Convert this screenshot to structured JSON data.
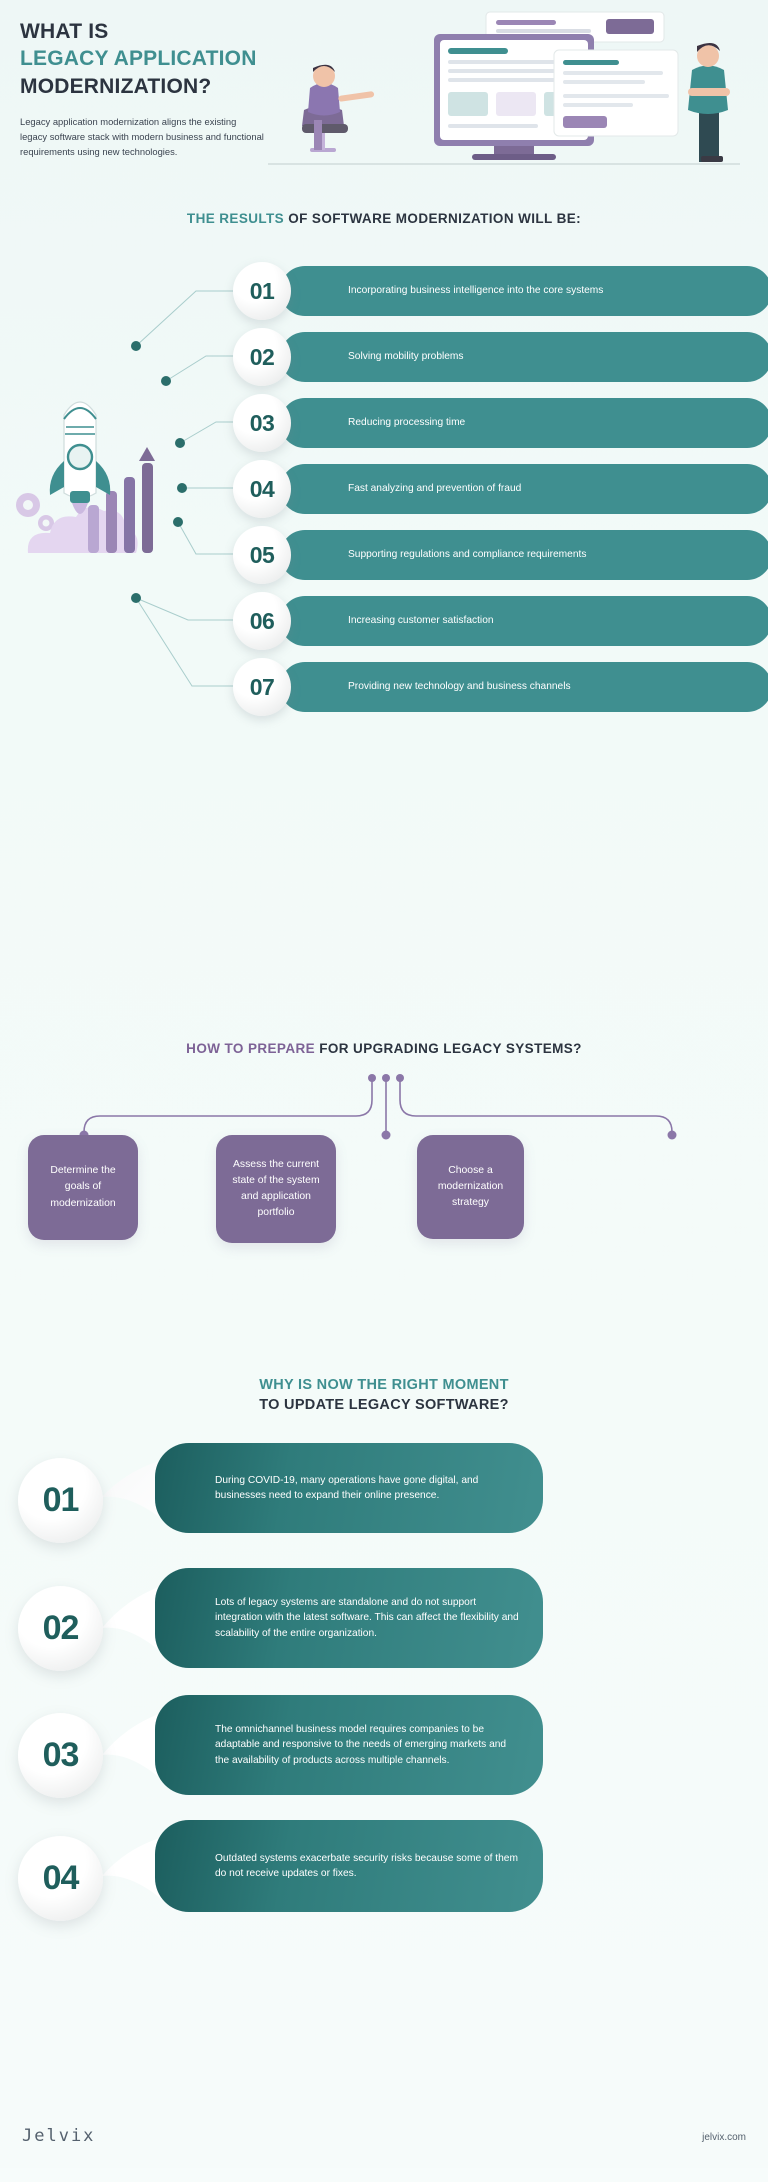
{
  "hero": {
    "title_line1": "WHAT IS",
    "title_line2": "LEGACY APPLICATION",
    "title_line3": "MODERNIZATION?",
    "paragraph": "Legacy application modernization aligns the existing legacy software stack with modern business and functional requirements using new technologies."
  },
  "results": {
    "title_accent": "THE RESULTS",
    "title_rest": " OF SOFTWARE MODERNIZATION WILL BE:",
    "items": [
      {
        "num": "01",
        "text": "Incorporating business intelligence into the core systems"
      },
      {
        "num": "02",
        "text": "Solving mobility problems"
      },
      {
        "num": "03",
        "text": "Reducing processing time"
      },
      {
        "num": "04",
        "text": "Fast analyzing and prevention of fraud"
      },
      {
        "num": "05",
        "text": "Supporting regulations and compliance requirements"
      },
      {
        "num": "06",
        "text": "Increasing customer satisfaction"
      },
      {
        "num": "07",
        "text": "Providing new technology and business channels"
      }
    ]
  },
  "prepare": {
    "title_accent": "HOW TO PREPARE",
    "title_rest": " FOR UPGRADING LEGACY SYSTEMS?",
    "boxes": [
      {
        "text": "Determine the goals of modernization"
      },
      {
        "text": "Assess the current state of the system and application portfolio"
      },
      {
        "text": "Choose a modernization strategy"
      }
    ]
  },
  "why": {
    "title_line1": "WHY IS NOW THE RIGHT MOMENT",
    "title_line2": "TO UPDATE LEGACY SOFTWARE?",
    "items": [
      {
        "num": "01",
        "text": "During COVID-19, many operations have gone digital, and businesses need to expand their online presence."
      },
      {
        "num": "02",
        "text": "Lots of legacy systems are standalone and do not support integration with the latest software. This can affect the flexibility and scalability of the entire organization."
      },
      {
        "num": "03",
        "text": "The omnichannel business model requires companies to be adaptable and responsive to the needs of emerging markets and the availability of products across multiple channels."
      },
      {
        "num": "04",
        "text": "Outdated systems exacerbate security risks because some of them do not receive updates or fixes."
      }
    ]
  },
  "footer": {
    "logo": "Jelvix",
    "site": "jelvix.com"
  },
  "colors": {
    "teal": "#3f8f90",
    "teal_dark": "#1f5e5c",
    "purple": "#7d6b96",
    "ink": "#2c3440",
    "bg": "#eef7f6"
  }
}
